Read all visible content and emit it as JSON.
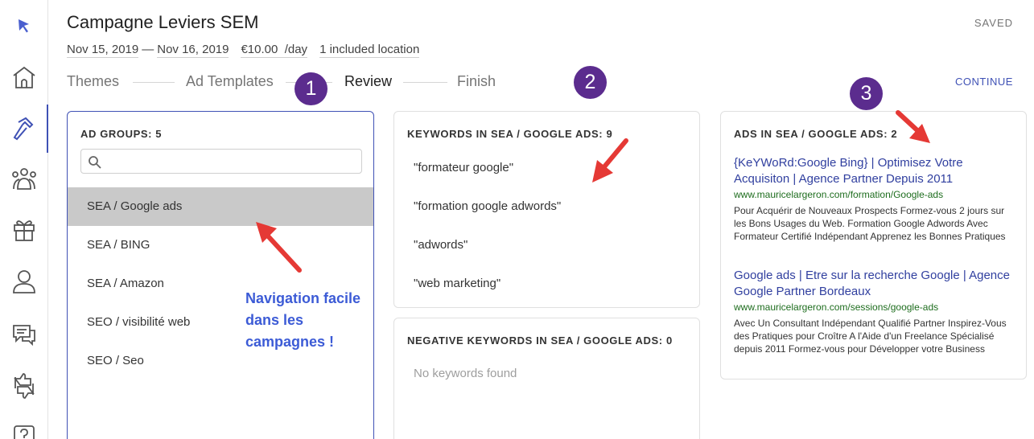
{
  "header": {
    "title": "Campagne Leviers SEM",
    "status": "SAVED",
    "start_date": "Nov 15, 2019",
    "date_separator": "—",
    "end_date": "Nov 16, 2019",
    "budget": "€10.00",
    "budget_unit": "/day",
    "locations": "1 included location"
  },
  "steps": [
    {
      "label": "Themes",
      "active": false
    },
    {
      "label": "Ad Templates",
      "active": false
    },
    {
      "label": "Review",
      "active": true
    },
    {
      "label": "Finish",
      "active": false
    }
  ],
  "continue_label": "CONTINUE",
  "badges": [
    "1",
    "2",
    "3"
  ],
  "sidebar": {
    "items": [
      "cursor-icon",
      "home-icon",
      "hammer-icon",
      "group-icon",
      "gift-icon",
      "person-icon",
      "chat-icon",
      "thumbs-icon",
      "help-icon"
    ],
    "active": "hammer-icon",
    "accent": "#3f51b5"
  },
  "ad_groups": {
    "heading": "AD GROUPS: 5",
    "search_placeholder": "",
    "items": [
      "SEA / Google ads",
      "SEA / BING",
      "SEA / Amazon",
      "SEO / visibilité web",
      "SEO / Seo"
    ],
    "selected_index": 0
  },
  "keywords": {
    "heading": "KEYWORDS IN SEA / GOOGLE ADS: 9",
    "items": [
      "\"formateur google\"",
      "\"formation google adwords\"",
      "\"adwords\"",
      "\"web marketing\""
    ]
  },
  "negative_keywords": {
    "heading": "NEGATIVE KEYWORDS IN SEA / GOOGLE ADS: 0",
    "empty_text": "No keywords found"
  },
  "ads": {
    "heading": "ADS IN SEA / GOOGLE ADS: 2",
    "items": [
      {
        "title": "{KeYWoRd:Google Bing} | Optimisez Votre Acquisiton | Agence Partner Depuis 2011",
        "url": "www.mauricelargeron.com/formation/Google-ads",
        "description": "Pour Acquérir de Nouveaux Prospects Formez-vous 2 jours sur les Bons Usages du Web. Formation Google Adwords Avec Formateur Certifié Indépendant Apprenez les Bonnes Pratiques"
      },
      {
        "title": "Google ads | Etre sur la recherche Google | Agence Google Partner Bordeaux",
        "url": "www.mauricelargeron.com/sessions/google-ads",
        "description": "Avec Un Consultant Indépendant Qualifié Partner Inspirez-Vous des Pratiques pour Croître A l'Aide d'un Freelance Spécialisé depuis 2011 Formez-vous pour Développer votre Business"
      }
    ]
  },
  "annotation": "Navigation facile dans les campagnes !"
}
